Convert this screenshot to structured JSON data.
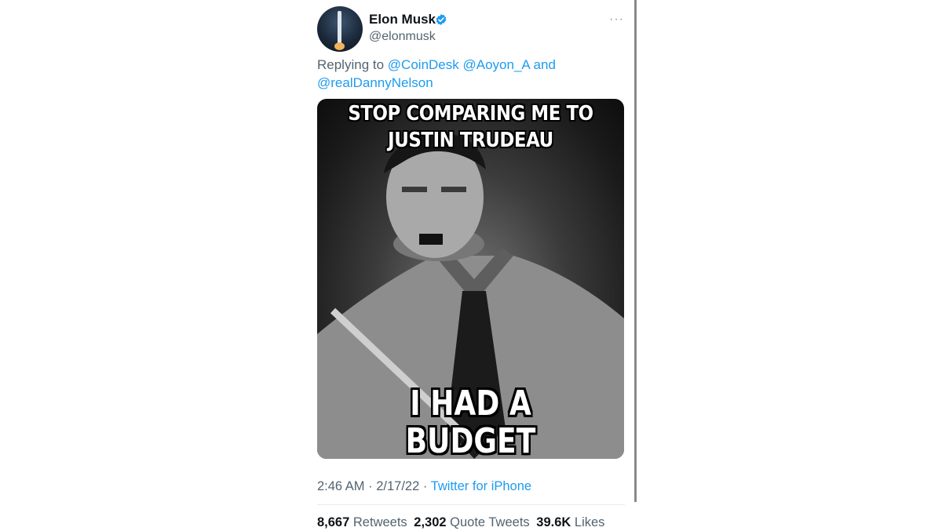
{
  "author": {
    "name": "Elon Musk",
    "handle": "@elonmusk",
    "verified": true,
    "avatar_icon": "rocket-launch-avatar"
  },
  "more_icon": "more-dots-icon",
  "reply": {
    "prefix": "Replying to",
    "mentions": [
      "@CoinDesk",
      "@Aoyon_A"
    ],
    "joiner": "and",
    "last_mention": "@realDannyNelson"
  },
  "media": {
    "top_text": "STOP COMPARING ME TO JUSTIN TRUDEAU",
    "bottom_text": "I HAD A BUDGET"
  },
  "meta": {
    "time": "2:46 AM",
    "date": "2/17/22",
    "source": "Twitter for iPhone"
  },
  "stats": {
    "retweets_count": "8,667",
    "retweets_label": "Retweets",
    "quotes_count": "2,302",
    "quotes_label": "Quote Tweets",
    "likes_count": "39.6K",
    "likes_label": "Likes"
  },
  "colors": {
    "link": "#1d9bf0",
    "secondary_text": "#536471",
    "primary_text": "#0f1419"
  }
}
